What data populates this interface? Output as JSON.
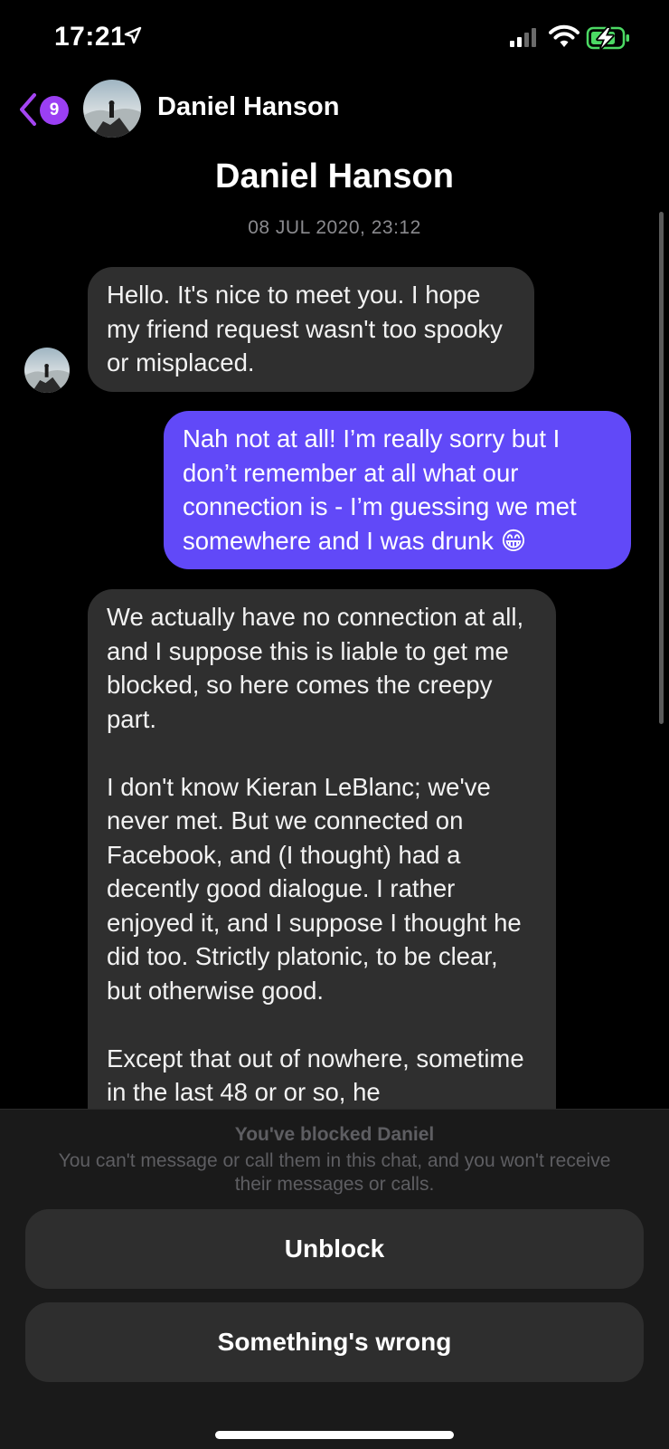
{
  "status_bar": {
    "time": "17:21",
    "icons": [
      "location-arrow-icon",
      "cellular-signal-icon",
      "wifi-icon",
      "battery-charging-icon"
    ]
  },
  "header": {
    "back_badge_count": "9",
    "contact_name": "Daniel Hanson"
  },
  "chat": {
    "title": "Daniel Hanson",
    "timestamp": "08 JUL 2020, 23:12",
    "messages": [
      {
        "direction": "incoming",
        "text": "Hello. It's nice to meet you. I hope my friend request wasn't too spooky or misplaced."
      },
      {
        "direction": "outgoing",
        "text": "Nah not at all! I’m really sorry but I don’t remember at all what our connection is - I’m guessing we met somewhere and I was drunk 😁"
      },
      {
        "direction": "incoming",
        "text": "We actually have no connection at all, and I suppose this is liable to get me blocked, so here comes the creepy part.\n\nI don't know Kieran LeBlanc; we've never met. But we connected on Facebook, and (I thought) had a decently good dialogue. I rather enjoyed it, and I suppose I thought he did too. Strictly platonic, to be clear, but otherwise good.\n\nExcept that out of nowhere, sometime in the last 48 or or so, he"
      }
    ]
  },
  "footer": {
    "blocked_title": "You've blocked Daniel",
    "blocked_description": "You can't message or call them in this chat, and you won't receive their messages or calls.",
    "unblock_label": "Unblock",
    "something_wrong_label": "Something's wrong"
  },
  "colors": {
    "outgoing_bubble": "#6149f8",
    "incoming_bubble": "#2f2f2f",
    "badge": "#9b3ff3",
    "back_chevron": "#a445f2",
    "scroll_arrow": "#3b8ef5",
    "battery_charging": "#4cd964"
  }
}
